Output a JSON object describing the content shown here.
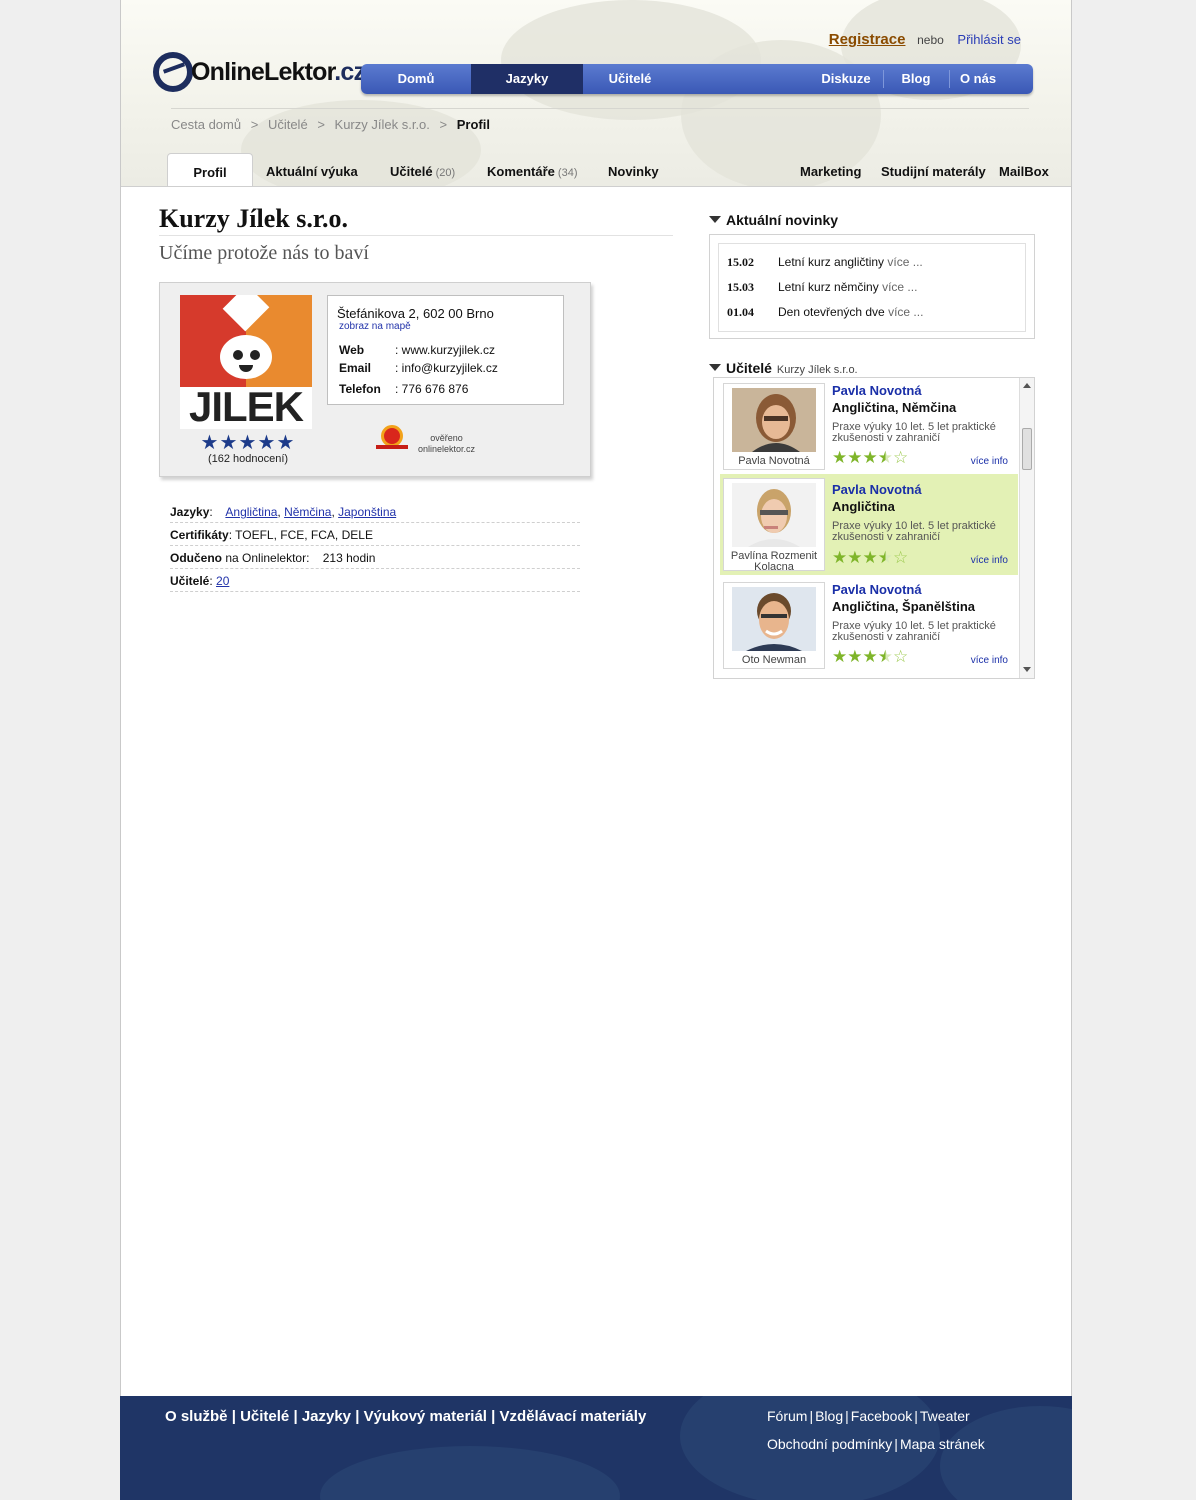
{
  "header": {
    "logo_main": "OnlineLektor",
    "logo_suffix": ".cz",
    "register": "Registrace",
    "or": "nebo",
    "login": "Přihlásit se"
  },
  "nav": [
    "Domů",
    "Jazyky",
    "Učitelé",
    "Diskuze",
    "Blog",
    "O nás"
  ],
  "nav_active": "Jazyky",
  "breadcrumb": [
    "Cesta domů",
    ">",
    "Učitelé",
    ">",
    "Kurzy Jílek s.r.o.",
    ">",
    "Profil"
  ],
  "tabs": {
    "profile": "Profil",
    "current": "Aktuální výuka",
    "teachers": "Učitelé",
    "teachers_count": "(20)",
    "comments": "Komentáře",
    "comments_count": "(34)",
    "news": "Novinky",
    "marketing": "Marketing",
    "materials": "Studijní materály",
    "mailbox": "MailBox"
  },
  "profile": {
    "title": "Kurzy Jílek s.r.o.",
    "subtitle": "Učíme protože nás to baví",
    "logo_text": "JILEK",
    "rating_stars": 5,
    "rating_count": "(162 hodnocení)",
    "address": "Štefánikova 2, 602 00 Brno",
    "map_link": "zobraz na mapě",
    "web_label": "Web",
    "web": ": www.kurzyjilek.cz",
    "email_label": "Email",
    "email": ": info@kurzyjilek.cz",
    "phone_label": "Telefon",
    "phone": ": 776 676 876",
    "verified_line1": "ověřeno",
    "verified_line2": "onlinelektor.cz"
  },
  "details": {
    "languages_label": "Jazyky",
    "languages": [
      "Angličtina",
      "Němčina",
      "Japonština"
    ],
    "certs_label": "Certifikáty",
    "certs": "TOEFL, FCE, FCA, DELE",
    "taught_label": "Odučeno",
    "taught_text": "na Onlinelektor:",
    "taught_value": "213 hodin",
    "teachers_label": "Učitelé",
    "teachers_value": "20"
  },
  "news": {
    "heading": "Aktuální novinky",
    "items": [
      {
        "date": "15.02",
        "text": "Letní kurz angličtiny",
        "more": "více ..."
      },
      {
        "date": "15.03",
        "text": "Letní kurz němčiny",
        "more": "více ..."
      },
      {
        "date": "01.04",
        "text": "Den otevřených dve",
        "more": "více ..."
      }
    ]
  },
  "teachers_box": {
    "heading": "Učitelé",
    "sub": "Kurzy Jílek s.r.o.",
    "items": [
      {
        "photo_name": "Pavla Novotná",
        "name": "Pavla Novotná",
        "langs": "Angličtina, Němčina",
        "desc": "Praxe výuky 10 let. 5 let praktické zkušenosti v zahraničí",
        "rating": 3.5,
        "more": "více info"
      },
      {
        "photo_name": "Pavlína Rozmenit Kolacna",
        "name": "Pavla Novotná",
        "langs": "Angličtina",
        "desc": "Praxe výuky 10 let. 5 let praktické zkušenosti v zahraničí",
        "rating": 3.5,
        "more": "více info"
      },
      {
        "photo_name": "Oto Newman",
        "name": "Pavla Novotná",
        "langs": "Angličtina, Španělština",
        "desc": "Praxe výuky 10 let. 5 let praktické zkušenosti v zahraničí",
        "rating": 3.5,
        "more": "více info"
      }
    ]
  },
  "footer": {
    "left": [
      "O službě",
      "Učitelé",
      "Jazyky",
      "Výukový materiál",
      "Vzdělávací materiály"
    ],
    "right1": [
      "Fórum",
      "Blog",
      "Facebook",
      "Tweater"
    ],
    "right2": [
      "Obchodní podmínky",
      "Mapa stránek"
    ],
    "separator": "|"
  },
  "colors": {
    "nav_blue": "#3a58b5",
    "nav_active": "#1f2f66",
    "footer_blue": "#1f3566",
    "highlight_green": "#e3f1b5",
    "star_green": "#7fb52a",
    "link_blue": "#1a2fa8"
  }
}
